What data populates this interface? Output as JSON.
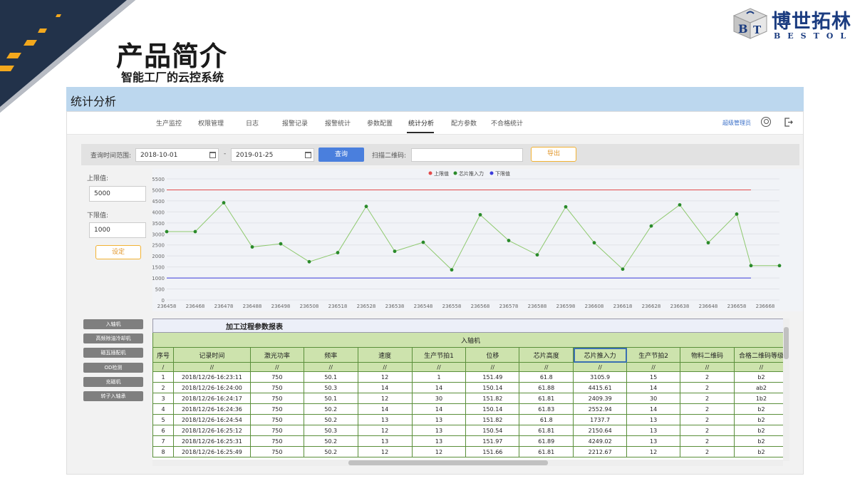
{
  "slide": {
    "title": "产品简介",
    "subtitle": "智能工厂的云控系统",
    "section": "统计分析"
  },
  "logo": {
    "text": "博世拓林",
    "sub": "BESTOL",
    "letters": "BT"
  },
  "nav": {
    "items": [
      "生产监控",
      "权限管理",
      "日志",
      "报警记录",
      "报警统计",
      "参数配置",
      "统计分析",
      "配方参数",
      "不合格统计"
    ],
    "active": "统计分析",
    "user": "超级管理员"
  },
  "query": {
    "range_label": "查询时间范围:",
    "start": "2018-10-01",
    "sep": "-",
    "end": "2019-01-25",
    "query_button": "查询",
    "qr_label": "扫描二维码:",
    "qr_value": "",
    "export_button": "导出"
  },
  "limits": {
    "upper_label": "上限值:",
    "upper_value": "5000",
    "lower_label": "下限值:",
    "lower_value": "1000",
    "set_button": "设定"
  },
  "chart_data": {
    "type": "line",
    "legend": [
      "上限值",
      "芯片推入力",
      "下限值"
    ],
    "legend_position": "top-center",
    "colors": {
      "upper": "#e34b4b",
      "series": "#2a8a2a",
      "line": "#8ec96e",
      "lower": "#3c3cdc"
    },
    "x": [
      "236458",
      "236463",
      "236468",
      "236473",
      "236478",
      "236483",
      "236488",
      "236493",
      "236498",
      "236503",
      "236508",
      "236513",
      "236518",
      "236523",
      "236528",
      "236533",
      "236538",
      "236543",
      "236548",
      "236553",
      "236558",
      "236563",
      "236568",
      "236573",
      "236578",
      "236583",
      "236588",
      "236593",
      "236598",
      "236603",
      "236608",
      "236613",
      "236618",
      "236623",
      "236628",
      "236633",
      "236638",
      "236643",
      "236648",
      "236653",
      "236658",
      "236663",
      "236668",
      "236673"
    ],
    "x_tick_labels": [
      "236458",
      "236468",
      "236478",
      "236488",
      "236498",
      "236508",
      "236518",
      "236528",
      "236538",
      "236548",
      "236558",
      "236568",
      "236578",
      "236588",
      "236598",
      "236608",
      "236618",
      "236628",
      "236638",
      "236648",
      "236658",
      "236668"
    ],
    "points": [
      {
        "x": 236458,
        "y": 3105
      },
      {
        "x": 236468,
        "y": 3105
      },
      {
        "x": 236478,
        "y": 4415
      },
      {
        "x": 236488,
        "y": 2409
      },
      {
        "x": 236498,
        "y": 2552
      },
      {
        "x": 236508,
        "y": 1737
      },
      {
        "x": 236518,
        "y": 2150
      },
      {
        "x": 236528,
        "y": 4249
      },
      {
        "x": 236538,
        "y": 2212
      },
      {
        "x": 236548,
        "y": 2620
      },
      {
        "x": 236558,
        "y": 1370
      },
      {
        "x": 236568,
        "y": 3870
      },
      {
        "x": 236578,
        "y": 2700
      },
      {
        "x": 236588,
        "y": 2050
      },
      {
        "x": 236598,
        "y": 4230
      },
      {
        "x": 236608,
        "y": 2600
      },
      {
        "x": 236618,
        "y": 1400
      },
      {
        "x": 236628,
        "y": 3360
      },
      {
        "x": 236638,
        "y": 4320
      },
      {
        "x": 236648,
        "y": 2600
      },
      {
        "x": 236658,
        "y": 3900
      },
      {
        "x": 236663,
        "y": 1560
      },
      {
        "x": 236673,
        "y": 1560
      }
    ],
    "upper": 5000,
    "lower": 1000,
    "upper_x_end": 236663,
    "lower_x_end": 236663,
    "ylim": [
      0,
      5500
    ],
    "yticks": [
      0,
      500,
      1000,
      1500,
      2000,
      2500,
      3000,
      3500,
      4000,
      4500,
      5000,
      5500
    ],
    "xlim": [
      236458,
      236673
    ],
    "grid": true
  },
  "side_buttons": [
    "入轴机",
    "高频除油冷却机",
    "磁瓦插配机",
    "OD检测",
    "充磁机",
    "转子入轴承"
  ],
  "table": {
    "title": "加工过程参数报表",
    "group": "入轴机",
    "columns": [
      "序号",
      "记录时间",
      "激光功率",
      "频率",
      "速度",
      "生产节拍1",
      "位移",
      "芯片高度",
      "芯片推入力",
      "生产节拍2",
      "物料二维码",
      "合格二维码等级"
    ],
    "units": [
      "/",
      "//",
      "//",
      "//",
      "//",
      "//",
      "//",
      "//",
      "//",
      "//",
      "//",
      "//"
    ],
    "rows": [
      [
        "1",
        "2018/12/26-16:23:11",
        "750",
        "50.1",
        "12",
        "1",
        "151.49",
        "61.8",
        "3105.9",
        "15",
        "2",
        "b2"
      ],
      [
        "2",
        "2018/12/26-16:24:00",
        "750",
        "50.3",
        "14",
        "14",
        "150.14",
        "61.88",
        "4415.61",
        "14",
        "2",
        "ab2"
      ],
      [
        "3",
        "2018/12/26-16:24:17",
        "750",
        "50.1",
        "12",
        "30",
        "151.82",
        "61.81",
        "2409.39",
        "30",
        "2",
        "1b2"
      ],
      [
        "4",
        "2018/12/26-16:24:36",
        "750",
        "50.2",
        "14",
        "14",
        "150.14",
        "61.83",
        "2552.94",
        "14",
        "2",
        "b2"
      ],
      [
        "5",
        "2018/12/26-16:24:54",
        "750",
        "50.2",
        "13",
        "13",
        "151.82",
        "61.8",
        "1737.7",
        "13",
        "2",
        "b2"
      ],
      [
        "6",
        "2018/12/26-16:25:12",
        "750",
        "50.3",
        "12",
        "13",
        "150.54",
        "61.81",
        "2150.64",
        "13",
        "2",
        "b2"
      ],
      [
        "7",
        "2018/12/26-16:25:31",
        "750",
        "50.2",
        "13",
        "13",
        "151.97",
        "61.89",
        "4249.02",
        "13",
        "2",
        "b2"
      ],
      [
        "8",
        "2018/12/26-16:25:49",
        "750",
        "50.2",
        "12",
        "12",
        "151.66",
        "61.81",
        "2212.67",
        "12",
        "2",
        "b2"
      ]
    ],
    "selected_column": "芯片推入力"
  }
}
